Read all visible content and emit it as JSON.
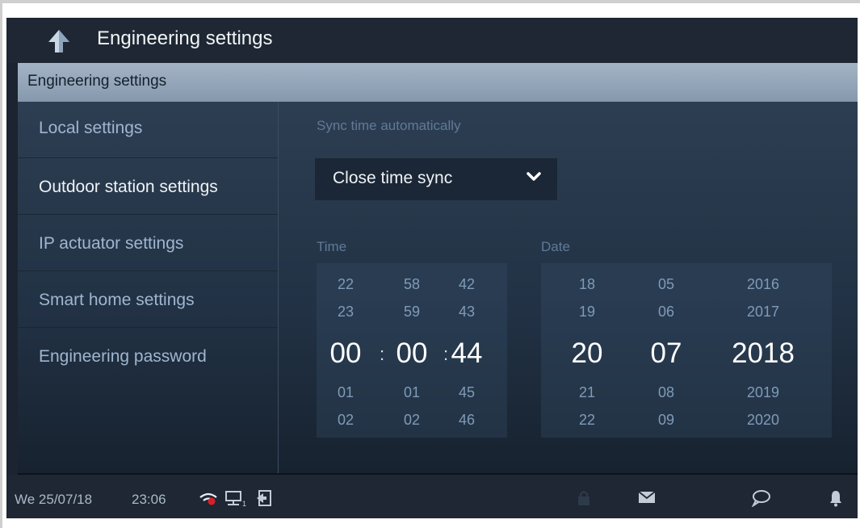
{
  "header": {
    "title": "Engineering settings",
    "back_icon": "back-arrow-icon"
  },
  "section": {
    "title": "Engineering settings"
  },
  "sidebar": {
    "items": [
      {
        "label": "Local settings"
      },
      {
        "label": "Outdoor station settings"
      },
      {
        "label": "IP actuator settings"
      },
      {
        "label": "Smart home settings"
      },
      {
        "label": "Engineering password"
      }
    ]
  },
  "sync": {
    "label": "Sync time automatically",
    "selected": "Close time sync",
    "icon": "chevron-down-icon"
  },
  "time": {
    "label": "Time",
    "hours": [
      "22",
      "23",
      "00",
      "01",
      "02"
    ],
    "minutes": [
      "58",
      "59",
      "00",
      "01",
      "02"
    ],
    "seconds": [
      "42",
      "43",
      "44",
      "45",
      "46"
    ],
    "separator": ":"
  },
  "date": {
    "label": "Date",
    "days": [
      "18",
      "19",
      "20",
      "21",
      "22"
    ],
    "months": [
      "05",
      "06",
      "07",
      "08",
      "09"
    ],
    "years": [
      "2016",
      "2017",
      "2018",
      "2019",
      "2020"
    ]
  },
  "status": {
    "date": "We 25/07/18",
    "time": "23:06",
    "icons": [
      "wifi-icon",
      "network-icon",
      "logout-icon",
      "lock-icon",
      "mail-icon",
      "chat-icon",
      "bell-icon"
    ],
    "wifi_color": "#d9202a",
    "network_index": "1"
  },
  "colors": {
    "background": "#1b2430",
    "section_bar": "#95a7bb",
    "accent_text": "#9fb6cf"
  }
}
